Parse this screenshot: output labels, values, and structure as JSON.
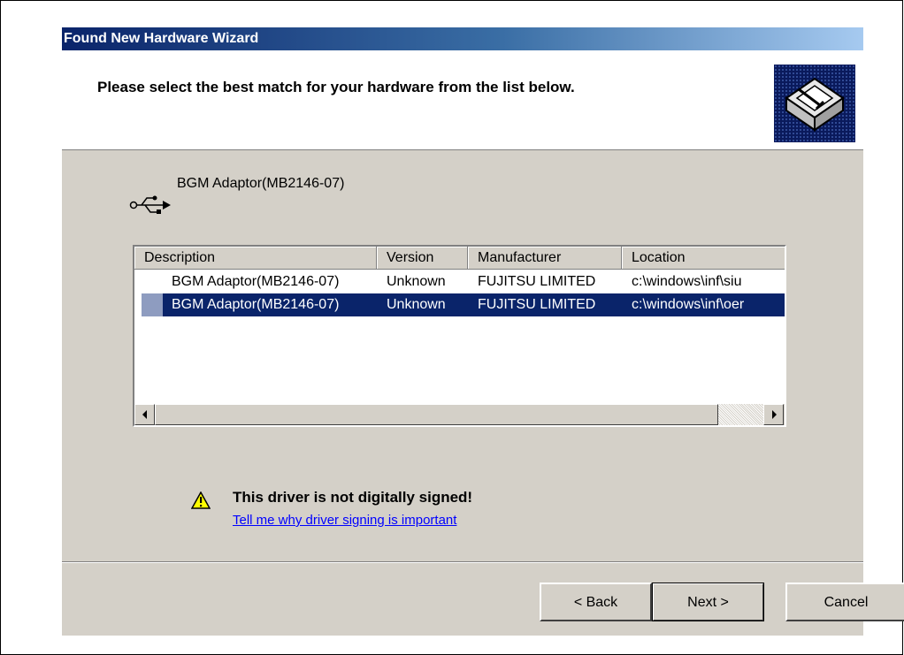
{
  "window": {
    "title": "Found New Hardware Wizard"
  },
  "header": {
    "title": "Please select the best match for your hardware from the list below.",
    "icon": "hardware-install-icon"
  },
  "device": {
    "icon": "usb-icon",
    "name": "BGM Adaptor(MB2146-07)"
  },
  "list": {
    "columns": [
      "Description",
      "Version",
      "Manufacturer",
      "Location"
    ],
    "rows": [
      {
        "description": "BGM Adaptor(MB2146-07)",
        "version": "Unknown",
        "manufacturer": "FUJITSU LIMITED",
        "location": "c:\\windows\\inf\\siu",
        "selected": false
      },
      {
        "description": "BGM Adaptor(MB2146-07)",
        "version": "Unknown",
        "manufacturer": "FUJITSU LIMITED",
        "location": "c:\\windows\\inf\\oer",
        "selected": true
      }
    ]
  },
  "warning": {
    "icon": "warning-icon",
    "title": "This driver is not digitally signed!",
    "link": "Tell me why driver signing is important"
  },
  "buttons": {
    "back": "< Back",
    "next": "Next >",
    "cancel": "Cancel"
  },
  "colors": {
    "titlebar": "#0a246a",
    "selection": "#0a246a",
    "dialog_bg": "#d4d0c8",
    "link": "#0000ff"
  }
}
